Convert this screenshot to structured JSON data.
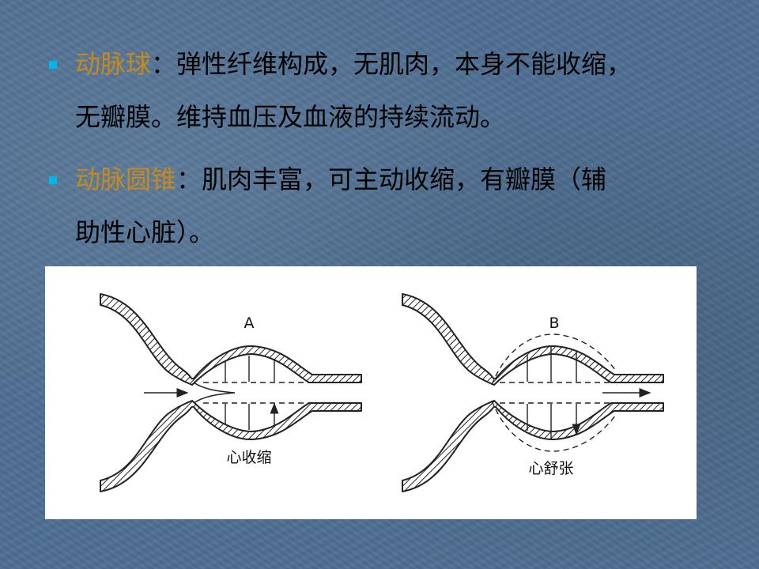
{
  "bullets": [
    {
      "term": "动脉球",
      "separator": "：",
      "line1_rest": "弹性纤维构成，无肌肉，本身不能收缩，",
      "line2": "无瓣膜。维持血压及血液的持续流动。"
    },
    {
      "term": "动脉圆锥",
      "separator": "：",
      "line1_rest": "肌肉丰富，可主动收缩，有瓣膜（辅",
      "line2": "助性心脏）。"
    }
  ],
  "colors": {
    "background": "#4f6f92",
    "term": "#c58a1e",
    "bullet": "#00b7ea",
    "text": "#000000"
  },
  "diagram": {
    "panel_a": {
      "letter": "A",
      "caption": "心收缩"
    },
    "panel_b": {
      "letter": "B",
      "caption": "心舒张"
    }
  }
}
